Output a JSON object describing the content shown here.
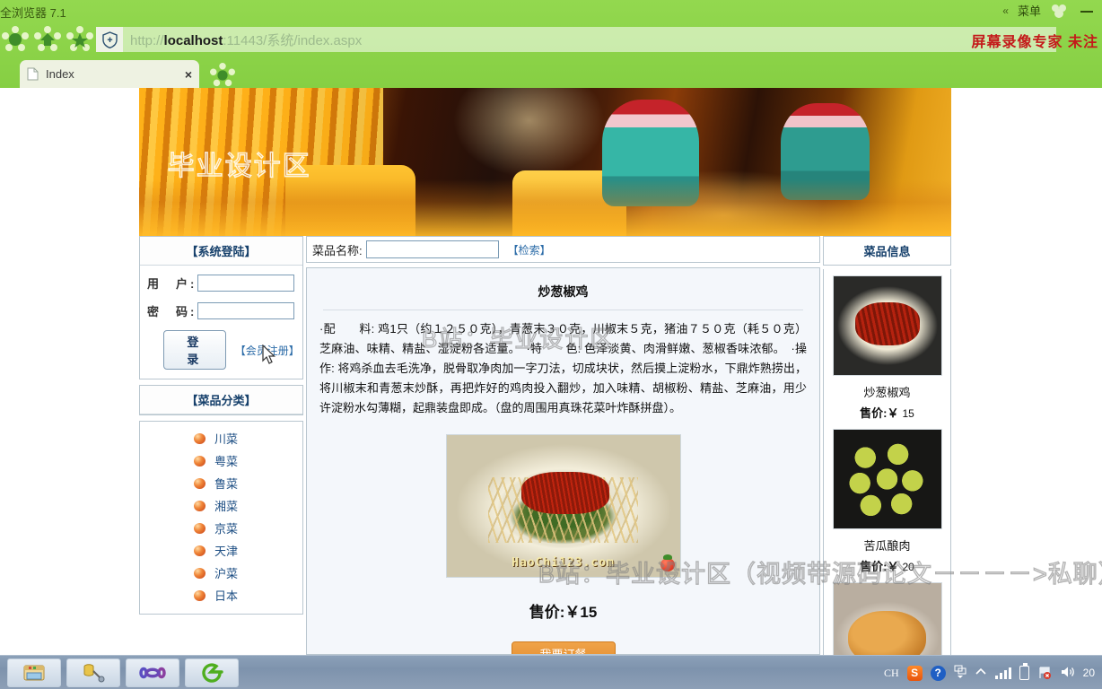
{
  "browser": {
    "window_title": "全浏览器 7.1",
    "menu_chevron": "«",
    "menu_label": "菜单",
    "url_scheme": "http://",
    "url_host": "localhost",
    "url_rest": ":11443/系统/index.aspx",
    "recorder_watermark": "屏幕录像专家  未注",
    "tab": {
      "label": "Index",
      "close": "×"
    },
    "icons": {
      "shield": "shield-icon",
      "back_flower": "back-flower-icon",
      "home_flower": "home-flower-icon",
      "star_flower": "star-flower-icon",
      "new_tab_flower": "new-tab-flower-icon",
      "page": "page-icon",
      "minimize": "minimize-icon"
    }
  },
  "watermarks": {
    "top": "B 站：  毕业设计区",
    "middle": "B站：毕业设计区",
    "bottom": "B站：毕业设计区（视频带源码论文－－－－>私聊）"
  },
  "login": {
    "title": "【系统登陆】",
    "username_label": "用　户:",
    "username_value": "",
    "password_label": "密　码:",
    "password_value": "",
    "login_button": "登　录",
    "register_link": "【会员注册】"
  },
  "categories": {
    "title": "【菜品分类】",
    "items": [
      {
        "label": "川菜"
      },
      {
        "label": "粤菜"
      },
      {
        "label": "鲁菜"
      },
      {
        "label": "湘菜"
      },
      {
        "label": "京菜"
      },
      {
        "label": "天津"
      },
      {
        "label": "沪菜"
      },
      {
        "label": "日本"
      }
    ]
  },
  "search": {
    "label": "菜品名称:",
    "value": "",
    "placeholder": "",
    "button": "【检索】"
  },
  "detail": {
    "dish_name": "炒葱椒鸡",
    "recipe": "·配　　料: 鸡1只（约１２５０克），青葱末３０克，川椒末５克，猪油７５０克（耗５０克）芝麻油、味精、精盐、湿淀粉各适量。　·特　　色: 色泽淡黄、肉滑鲜嫩、葱椒香味浓郁。　·操　　作: 将鸡杀血去毛洗净，脱骨取净肉加一字刀法，切成块状，然后摸上淀粉水，下鼎炸熟捞出，将川椒末和青葱末炒酥，再把炸好的鸡肉投入翻炒，加入味精、胡椒粉、精盐、芝麻油，用少许淀粉水勾薄糊，起鼎装盘即成。（盘的周围用真珠花菜叶炸酥拼盘）。",
    "photo_watermark": "HaoChi123.com",
    "price": "售价:￥15",
    "order_button": "我要订餐"
  },
  "info_panel": {
    "title": "菜品信息",
    "dishes": [
      {
        "name": "炒葱椒鸡",
        "price_label": "售价:￥",
        "price_value": "15"
      },
      {
        "name": "苦瓜酿肉",
        "price_label": "售价:￥",
        "price_value": "20"
      },
      {
        "name": "",
        "price_label": "",
        "price_value": ""
      }
    ]
  },
  "taskbar": {
    "buttons": [
      {
        "name": "file-explorer"
      },
      {
        "name": "database-tools"
      },
      {
        "name": "visual-studio"
      },
      {
        "name": "green-browser"
      }
    ],
    "tray": {
      "ime": "CH",
      "sogou": "S",
      "help": "?",
      "clock": "20"
    }
  },
  "colors": {
    "chrome_green": "#8ed44a",
    "accent_blue": "#16406b",
    "link_blue": "#2c6ca8",
    "order_orange": "#e08a2b",
    "watermark_red": "#c41a1a"
  }
}
